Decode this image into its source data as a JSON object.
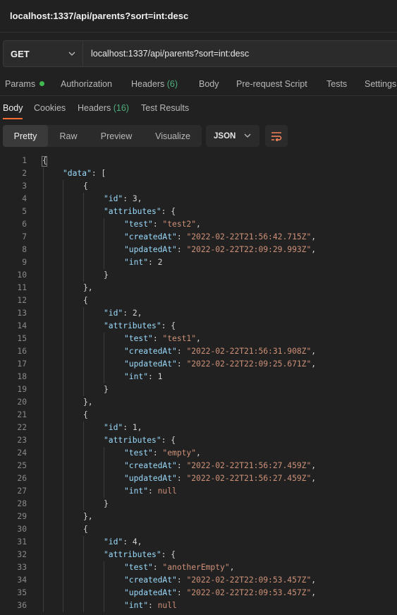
{
  "window": {
    "title": "localhost:1337/api/parents?sort=int:desc"
  },
  "request": {
    "method": "GET",
    "url": "localhost:1337/api/parents?sort=int:desc"
  },
  "request_tabs": {
    "params": "Params",
    "authorization": "Authorization",
    "headers": "Headers",
    "headers_count": "(6)",
    "body": "Body",
    "prerequest": "Pre-request Script",
    "tests": "Tests",
    "settings": "Settings"
  },
  "response_tabs": {
    "body": "Body",
    "cookies": "Cookies",
    "headers": "Headers",
    "headers_count": "(16)",
    "test_results": "Test Results"
  },
  "view": {
    "pretty": "Pretty",
    "raw": "Raw",
    "preview": "Preview",
    "visualize": "Visualize",
    "language": "JSON"
  },
  "response_body": {
    "records": [
      {
        "id": "3",
        "test": "\"test2\"",
        "createdAt": "\"2022-02-22T21:56:42.715Z\"",
        "updatedAt": "\"2022-02-22T22:09:29.993Z\"",
        "int": "2"
      },
      {
        "id": "2",
        "test": "\"test1\"",
        "createdAt": "\"2022-02-22T21:56:31.908Z\"",
        "updatedAt": "\"2022-02-22T22:09:25.671Z\"",
        "int": "1"
      },
      {
        "id": "1",
        "test": "\"empty\"",
        "createdAt": "\"2022-02-22T21:56:27.459Z\"",
        "updatedAt": "\"2022-02-22T21:56:27.459Z\"",
        "int": "null"
      },
      {
        "id": "4",
        "test": "\"anotherEmpty\"",
        "createdAt": "\"2022-02-22T22:09:53.457Z\"",
        "updatedAt": "\"2022-02-22T22:09:53.457Z\"",
        "int": "null"
      }
    ]
  },
  "colors": {
    "accent": "#ff6c37",
    "key": "#9cdcfe",
    "string": "#ce9178",
    "count": "#4caf7a",
    "dot": "#3fb950"
  }
}
